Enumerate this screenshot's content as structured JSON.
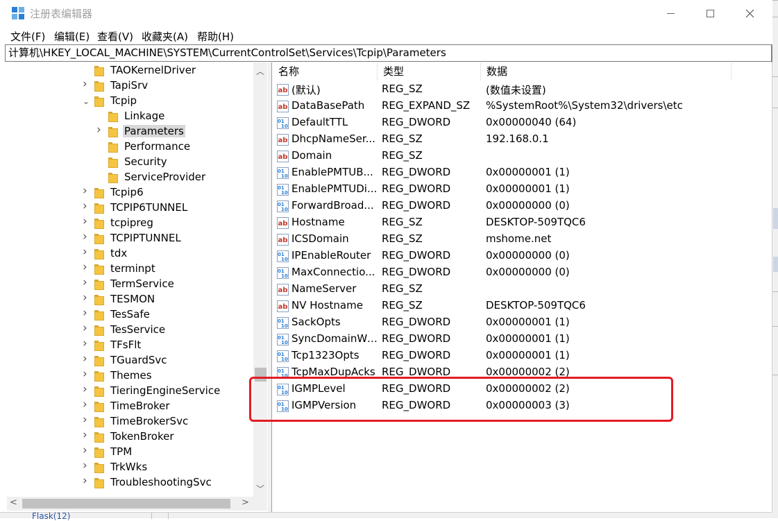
{
  "window": {
    "title": "注册表编辑器"
  },
  "menu": [
    "文件(F)",
    "编辑(E)",
    "查看(V)",
    "收藏夹(A)",
    "帮助(H)"
  ],
  "address": "计算机\\HKEY_LOCAL_MACHINE\\SYSTEM\\CurrentControlSet\\Services\\Tcpip\\Parameters",
  "tree": {
    "items": [
      {
        "label": "TAOKernelDriver",
        "level": 1,
        "expander": "none",
        "selected": false
      },
      {
        "label": "TapiSrv",
        "level": 1,
        "expander": "collapsed",
        "selected": false
      },
      {
        "label": "Tcpip",
        "level": 1,
        "expander": "expanded",
        "selected": false
      },
      {
        "label": "Linkage",
        "level": 2,
        "expander": "none",
        "selected": false
      },
      {
        "label": "Parameters",
        "level": 2,
        "expander": "collapsed",
        "selected": true
      },
      {
        "label": "Performance",
        "level": 2,
        "expander": "none",
        "selected": false
      },
      {
        "label": "Security",
        "level": 2,
        "expander": "none",
        "selected": false
      },
      {
        "label": "ServiceProvider",
        "level": 2,
        "expander": "none",
        "selected": false
      },
      {
        "label": "Tcpip6",
        "level": 1,
        "expander": "collapsed",
        "selected": false
      },
      {
        "label": "TCPIP6TUNNEL",
        "level": 1,
        "expander": "collapsed",
        "selected": false
      },
      {
        "label": "tcpipreg",
        "level": 1,
        "expander": "collapsed",
        "selected": false
      },
      {
        "label": "TCPIPTUNNEL",
        "level": 1,
        "expander": "collapsed",
        "selected": false
      },
      {
        "label": "tdx",
        "level": 1,
        "expander": "collapsed",
        "selected": false
      },
      {
        "label": "terminpt",
        "level": 1,
        "expander": "collapsed",
        "selected": false
      },
      {
        "label": "TermService",
        "level": 1,
        "expander": "collapsed",
        "selected": false
      },
      {
        "label": "TESMON",
        "level": 1,
        "expander": "collapsed",
        "selected": false
      },
      {
        "label": "TesSafe",
        "level": 1,
        "expander": "collapsed",
        "selected": false
      },
      {
        "label": "TesService",
        "level": 1,
        "expander": "collapsed",
        "selected": false
      },
      {
        "label": "TFsFlt",
        "level": 1,
        "expander": "collapsed",
        "selected": false
      },
      {
        "label": "TGuardSvc",
        "level": 1,
        "expander": "collapsed",
        "selected": false
      },
      {
        "label": "Themes",
        "level": 1,
        "expander": "collapsed",
        "selected": false
      },
      {
        "label": "TieringEngineService",
        "level": 1,
        "expander": "collapsed",
        "selected": false
      },
      {
        "label": "TimeBroker",
        "level": 1,
        "expander": "collapsed",
        "selected": false
      },
      {
        "label": "TimeBrokerSvc",
        "level": 1,
        "expander": "collapsed",
        "selected": false
      },
      {
        "label": "TokenBroker",
        "level": 1,
        "expander": "collapsed",
        "selected": false
      },
      {
        "label": "TPM",
        "level": 1,
        "expander": "collapsed",
        "selected": false
      },
      {
        "label": "TrkWks",
        "level": 1,
        "expander": "collapsed",
        "selected": false
      },
      {
        "label": "TroubleshootingSvc",
        "level": 1,
        "expander": "collapsed",
        "selected": false
      }
    ]
  },
  "list": {
    "columns": {
      "name": "名称",
      "type": "类型",
      "data": "数据"
    },
    "rows": [
      {
        "name": "(默认)",
        "type": "REG_SZ",
        "data": "(数值未设置)",
        "icon": "string-value-icon"
      },
      {
        "name": "DataBasePath",
        "type": "REG_EXPAND_SZ",
        "data": "%SystemRoot%\\System32\\drivers\\etc",
        "icon": "string-value-icon"
      },
      {
        "name": "DefaultTTL",
        "type": "REG_DWORD",
        "data": "0x00000040 (64)",
        "icon": "binary-value-icon"
      },
      {
        "name": "DhcpNameSer...",
        "type": "REG_SZ",
        "data": "192.168.0.1",
        "icon": "string-value-icon"
      },
      {
        "name": "Domain",
        "type": "REG_SZ",
        "data": "",
        "icon": "string-value-icon"
      },
      {
        "name": "EnablePMTUB...",
        "type": "REG_DWORD",
        "data": "0x00000001 (1)",
        "icon": "binary-value-icon"
      },
      {
        "name": "EnablePMTUDi...",
        "type": "REG_DWORD",
        "data": "0x00000001 (1)",
        "icon": "binary-value-icon"
      },
      {
        "name": "ForwardBroad...",
        "type": "REG_DWORD",
        "data": "0x00000000 (0)",
        "icon": "binary-value-icon"
      },
      {
        "name": "Hostname",
        "type": "REG_SZ",
        "data": "DESKTOP-509TQC6",
        "icon": "string-value-icon"
      },
      {
        "name": "ICSDomain",
        "type": "REG_SZ",
        "data": "mshome.net",
        "icon": "string-value-icon"
      },
      {
        "name": "IPEnableRouter",
        "type": "REG_DWORD",
        "data": "0x00000000 (0)",
        "icon": "binary-value-icon"
      },
      {
        "name": "MaxConnectio...",
        "type": "REG_DWORD",
        "data": "0x00000000 (0)",
        "icon": "binary-value-icon"
      },
      {
        "name": "NameServer",
        "type": "REG_SZ",
        "data": "",
        "icon": "string-value-icon"
      },
      {
        "name": "NV Hostname",
        "type": "REG_SZ",
        "data": "DESKTOP-509TQC6",
        "icon": "string-value-icon"
      },
      {
        "name": "SackOpts",
        "type": "REG_DWORD",
        "data": "0x00000001 (1)",
        "icon": "binary-value-icon"
      },
      {
        "name": "SyncDomainWi...",
        "type": "REG_DWORD",
        "data": "0x00000001 (1)",
        "icon": "binary-value-icon"
      },
      {
        "name": "Tcp1323Opts",
        "type": "REG_DWORD",
        "data": "0x00000001 (1)",
        "icon": "binary-value-icon"
      },
      {
        "name": "TcpMaxDupAcks",
        "type": "REG_DWORD",
        "data": "0x00000002 (2)",
        "icon": "binary-value-icon"
      },
      {
        "name": "IGMPLevel",
        "type": "REG_DWORD",
        "data": "0x00000002 (2)",
        "icon": "binary-value-icon"
      },
      {
        "name": "IGMPVersion",
        "type": "REG_DWORD",
        "data": "0x00000003 (3)",
        "icon": "binary-value-icon"
      }
    ]
  },
  "background": {
    "flask": "Flask(12)"
  },
  "colors": {
    "highlight": "#e41b23",
    "folder": "#f5c542",
    "selection": "#d9d9d9",
    "icon_blue": "#2b7fd6",
    "string_icon_red": "#c0392b"
  }
}
